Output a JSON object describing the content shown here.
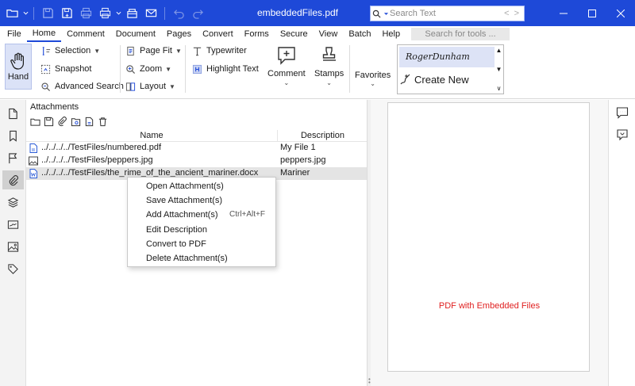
{
  "window": {
    "title": "embeddedFiles.pdf",
    "search_placeholder": "Search Text",
    "search_prev": "<",
    "search_next": ">"
  },
  "menu": {
    "items": [
      "File",
      "Home",
      "Comment",
      "Document",
      "Pages",
      "Convert",
      "Forms",
      "Secure",
      "View",
      "Batch",
      "Help"
    ],
    "active": "Home",
    "tool_search_placeholder": "Search for tools ..."
  },
  "ribbon": {
    "hand": "Hand",
    "selection": "Selection",
    "snapshot": "Snapshot",
    "advanced_search": "Advanced Search",
    "page_fit": "Page Fit",
    "zoom": "Zoom",
    "layout": "Layout",
    "typewriter": "Typewriter",
    "highlight_text": "Highlight Text",
    "comment": "Comment",
    "stamps": "Stamps",
    "favorites": "Favorites",
    "signature_name": "RogerDunham",
    "create_new": "Create New"
  },
  "attachments": {
    "title": "Attachments",
    "columns": {
      "name": "Name",
      "description": "Description"
    },
    "rows": [
      {
        "name": "../../../../TestFiles/numbered.pdf",
        "description": "My File 1",
        "icon": "pdf-file-icon"
      },
      {
        "name": "../../../../TestFiles/peppers.jpg",
        "description": "peppers.jpg",
        "icon": "image-file-icon"
      },
      {
        "name": "../../../../TestFiles/the_rime_of_the_ancient_mariner.docx",
        "description": "Mariner",
        "icon": "word-file-icon"
      }
    ],
    "selected_row": 2
  },
  "context_menu": {
    "items": [
      {
        "label": "Open Attachment(s)",
        "shortcut": ""
      },
      {
        "label": "Save Attachment(s)",
        "shortcut": ""
      },
      {
        "label": "Add Attachment(s)",
        "shortcut": "Ctrl+Alt+F"
      },
      {
        "label": "Edit Description",
        "shortcut": ""
      },
      {
        "label": "Convert to PDF",
        "shortcut": ""
      },
      {
        "label": "Delete Attachment(s)",
        "shortcut": ""
      }
    ]
  },
  "document": {
    "page_text": "PDF with Embedded Files",
    "page_text_color": "#e02020"
  },
  "colors": {
    "titlebar": "#1e49d8",
    "accent": "#1e49d8"
  }
}
